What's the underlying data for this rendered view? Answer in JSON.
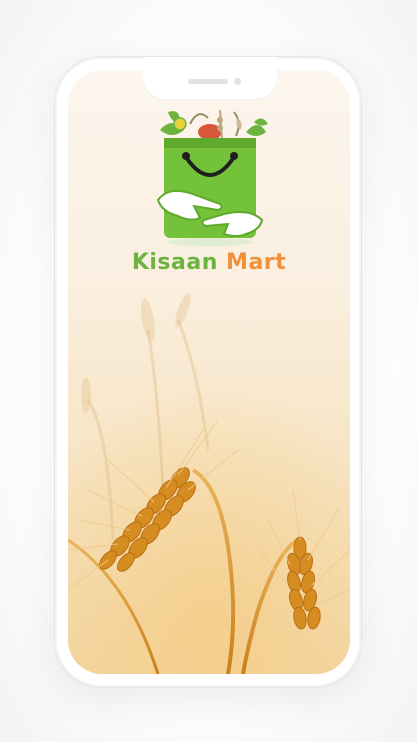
{
  "app": {
    "brand_name_part1": "Kisaan",
    "brand_name_part2": "Mart"
  },
  "icons": {
    "logo": "shopping-bag-smile-hands-icon"
  },
  "colors": {
    "brand_green": "#6db33f",
    "brand_orange": "#f0913a",
    "bag_green": "#74c13a",
    "wheat_gold": "#d99a2b"
  }
}
